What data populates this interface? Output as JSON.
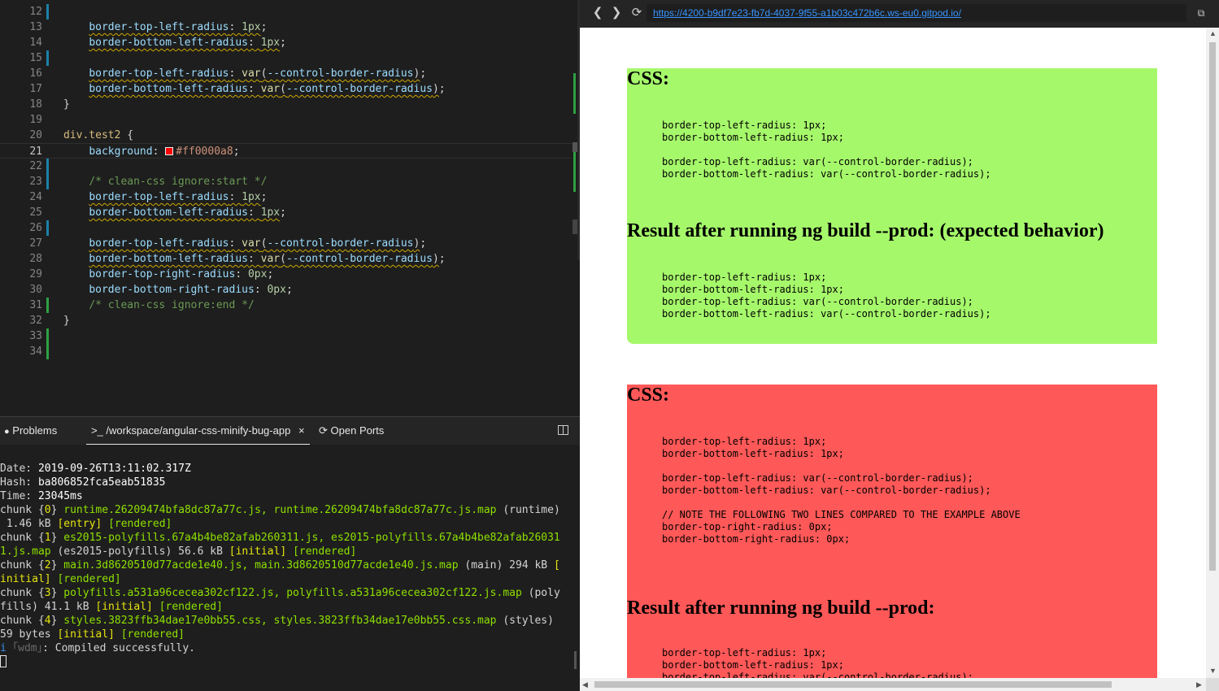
{
  "editor": {
    "lines": [
      {
        "n": "12",
        "html": "<span class='t-prop'>  </span>"
      },
      {
        "n": "13",
        "html": "    <span class='squig'><span class='t-prop'>border-top-left-radius</span><span class='t-pun'>: </span><span class='t-num'>1px</span></span><span class='t-pun'>;</span>"
      },
      {
        "n": "14",
        "html": "    <span class='squig'><span class='t-prop'>border-bottom-left-radius</span><span class='t-pun'>: </span><span class='t-num'>1px</span></span><span class='t-pun'>;</span>"
      },
      {
        "n": "15",
        "html": ""
      },
      {
        "n": "16",
        "html": "    <span class='squig'><span class='t-prop'>border-top-left-radius</span><span class='t-pun'>: </span><span class='t-fn'>var</span><span class='t-pun'>(</span><span class='t-prop'>--control-border-radius</span><span class='t-pun'>)</span></span><span class='t-pun'>;</span>"
      },
      {
        "n": "17",
        "html": "    <span class='squig'><span class='t-prop'>border-bottom-left-radius</span><span class='t-pun'>: </span><span class='t-fn'>var</span><span class='t-pun'>(</span><span class='t-prop'>--control-border-radius</span><span class='t-pun'>)</span></span><span class='t-pun'>;</span>"
      },
      {
        "n": "18",
        "html": "<span class='t-pun'>}</span>"
      },
      {
        "n": "19",
        "html": ""
      },
      {
        "n": "20",
        "html": "<span class='t-sel'>div.test2</span><span class='t-pun'> {</span>"
      },
      {
        "n": "21",
        "html": "    <span class='t-prop'>background</span><span class='t-pun'>: </span><span class='swatch'></span><span class='t-str'>#ff0000a8</span><span class='t-pun'>;</span>"
      },
      {
        "n": "22",
        "html": ""
      },
      {
        "n": "23",
        "html": "    <span class='t-cmt'>/* clean-css ignore:start */</span>"
      },
      {
        "n": "24",
        "html": "    <span class='squig'><span class='t-prop'>border-top-left-radius</span><span class='t-pun'>: </span><span class='t-num'>1px</span></span><span class='t-pun'>;</span>"
      },
      {
        "n": "25",
        "html": "    <span class='squig'><span class='t-prop'>border-bottom-left-radius</span><span class='t-pun'>: </span><span class='t-num'>1px</span></span><span class='t-pun'>;</span>"
      },
      {
        "n": "26",
        "html": ""
      },
      {
        "n": "27",
        "html": "    <span class='squig'><span class='t-prop'>border-top-left-radius</span><span class='t-pun'>: </span><span class='t-fn'>var</span><span class='t-pun'>(</span><span class='t-prop'>--control-border-radius</span><span class='t-pun'>)</span></span><span class='t-pun'>;</span>"
      },
      {
        "n": "28",
        "html": "    <span class='squig'><span class='t-prop'>border-bottom-left-radius</span><span class='t-pun'>: </span><span class='t-fn'>var</span><span class='t-pun'>(</span><span class='t-prop'>--control-border-radius</span><span class='t-pun'>)</span></span><span class='t-pun'>;</span>"
      },
      {
        "n": "29",
        "html": "    <span class='t-prop'>border-top-right-radius</span><span class='t-pun'>: </span><span class='t-num'>0px</span><span class='t-pun'>;</span>"
      },
      {
        "n": "30",
        "html": "    <span class='t-prop'>border-bottom-right-radius</span><span class='t-pun'>: </span><span class='t-num'>0px</span><span class='t-pun'>;</span>"
      },
      {
        "n": "31",
        "html": "    <span class='t-cmt'>/* clean-css ignore:end */</span>"
      },
      {
        "n": "32",
        "html": "<span class='t-pun'>}</span>"
      },
      {
        "n": "33",
        "html": ""
      },
      {
        "n": "34",
        "html": ""
      }
    ],
    "line_texts": [
      "",
      "border-top-left-radius: 1px;",
      "border-bottom-left-radius: 1px;",
      "",
      "border-top-left-radius: var(--control-border-radius);",
      "border-bottom-left-radius: var(--control-border-radius);",
      "}",
      "",
      "div.test2 {",
      "background: #ff0000a8;",
      "",
      "/* clean-css ignore:start */",
      "border-top-left-radius: 1px;",
      "border-bottom-left-radius: 1px;",
      "",
      "border-top-left-radius: var(--control-border-radius);",
      "border-bottom-left-radius: var(--control-border-radius);",
      "border-top-right-radius: 0px;",
      "border-bottom-right-radius: 0px;",
      "/* clean-css ignore:end */",
      "}",
      "",
      ""
    ]
  },
  "panel": {
    "tabs": {
      "problems": "Problems",
      "terminal": ">_ /workspace/angular-css-minify-bug-app",
      "close": "×",
      "ports": "Open Ports"
    },
    "terminal_lines": [
      [
        {
          "c": "",
          "t": "Date: "
        },
        {
          "c": "tw",
          "t": "2019-09-26T13:11:02.317Z"
        }
      ],
      [
        {
          "c": "",
          "t": "Hash: "
        },
        {
          "c": "tw",
          "t": "ba806852fca5eab51835"
        }
      ],
      [
        {
          "c": "",
          "t": "Time: "
        },
        {
          "c": "tw",
          "t": "23045ms"
        }
      ],
      [
        {
          "c": "",
          "t": "chunk {"
        },
        {
          "c": "ty",
          "t": "0"
        },
        {
          "c": "",
          "t": "} "
        },
        {
          "c": "tg",
          "t": "runtime.26209474bfa8dc87a77c.js, runtime.26209474bfa8dc87a77c.js.map"
        },
        {
          "c": "",
          "t": " (runtime)"
        }
      ],
      [
        {
          "c": "",
          "t": " 1.46 kB "
        },
        {
          "c": "ty",
          "t": "[entry]"
        },
        {
          "c": "",
          "t": " "
        },
        {
          "c": "tg",
          "t": "[rendered]"
        }
      ],
      [
        {
          "c": "",
          "t": "chunk {"
        },
        {
          "c": "ty",
          "t": "1"
        },
        {
          "c": "",
          "t": "} "
        },
        {
          "c": "tg",
          "t": "es2015-polyfills.67a4b4be82afab260311.js, es2015-polyfills.67a4b4be82afab26031"
        }
      ],
      [
        {
          "c": "tg",
          "t": "1.js.map"
        },
        {
          "c": "",
          "t": " (es2015-polyfills) 56.6 kB "
        },
        {
          "c": "ty",
          "t": "[initial]"
        },
        {
          "c": "",
          "t": " "
        },
        {
          "c": "tg",
          "t": "[rendered]"
        }
      ],
      [
        {
          "c": "",
          "t": "chunk {"
        },
        {
          "c": "ty",
          "t": "2"
        },
        {
          "c": "",
          "t": "} "
        },
        {
          "c": "tg",
          "t": "main.3d8620510d77acde1e40.js, main.3d8620510d77acde1e40.js.map"
        },
        {
          "c": "",
          "t": " (main) 294 kB "
        },
        {
          "c": "ty",
          "t": "["
        }
      ],
      [
        {
          "c": "ty",
          "t": "initial]"
        },
        {
          "c": "",
          "t": " "
        },
        {
          "c": "tg",
          "t": "[rendered]"
        }
      ],
      [
        {
          "c": "",
          "t": "chunk {"
        },
        {
          "c": "ty",
          "t": "3"
        },
        {
          "c": "",
          "t": "} "
        },
        {
          "c": "tg",
          "t": "polyfills.a531a96cecea302cf122.js, polyfills.a531a96cecea302cf122.js.map"
        },
        {
          "c": "",
          "t": " (poly"
        }
      ],
      [
        {
          "c": "",
          "t": "fills) 41.1 kB "
        },
        {
          "c": "ty",
          "t": "[initial]"
        },
        {
          "c": "",
          "t": " "
        },
        {
          "c": "tg",
          "t": "[rendered]"
        }
      ],
      [
        {
          "c": "",
          "t": "chunk {"
        },
        {
          "c": "ty",
          "t": "4"
        },
        {
          "c": "",
          "t": "} "
        },
        {
          "c": "tg",
          "t": "styles.3823ffb34dae17e0bb55.css, styles.3823ffb34dae17e0bb55.css.map"
        },
        {
          "c": "",
          "t": " (styles)"
        }
      ],
      [
        {
          "c": "",
          "t": "59 bytes "
        },
        {
          "c": "ty",
          "t": "[initial]"
        },
        {
          "c": "",
          "t": " "
        },
        {
          "c": "tg",
          "t": "[rendered]"
        }
      ],
      [
        {
          "c": "tb",
          "t": "i"
        },
        {
          "c": "tdim",
          "t": " ｢wdm｣"
        },
        {
          "c": "",
          "t": ": Compiled successfully."
        }
      ]
    ]
  },
  "browser": {
    "url": "https://4200-b9df7e23-fb7d-4037-9f55-a1b03c472b6c.ws-eu0.gitpod.io/",
    "green_card": {
      "heading1": "CSS:",
      "code1": "border-top-left-radius: 1px;\nborder-bottom-left-radius: 1px;\n\nborder-top-left-radius: var(--control-border-radius);\nborder-bottom-left-radius: var(--control-border-radius);",
      "heading2": "Result after running ng build --prod: (expected behavior)",
      "code2": "border-top-left-radius: 1px;\nborder-bottom-left-radius: 1px;\nborder-top-left-radius: var(--control-border-radius);\nborder-bottom-left-radius: var(--control-border-radius);"
    },
    "red_card": {
      "heading1": "CSS:",
      "code1": "border-top-left-radius: 1px;\nborder-bottom-left-radius: 1px;\n\nborder-top-left-radius: var(--control-border-radius);\nborder-bottom-left-radius: var(--control-border-radius);\n\n// NOTE THE FOLLOWING TWO LINES COMPARED TO THE EXAMPLE ABOVE\nborder-top-right-radius: 0px;\nborder-bottom-right-radius: 0px;",
      "heading2": "Result after running ng build --prod:",
      "code2": "border-top-left-radius: 1px;\nborder-bottom-left-radius: 1px;\nborder-top-left-radius: var(--control-border-radius);"
    }
  },
  "colors": {
    "green_card_bg": "#a6f86b",
    "red_card_bg": "#ff5858",
    "link": "#3794ff"
  }
}
